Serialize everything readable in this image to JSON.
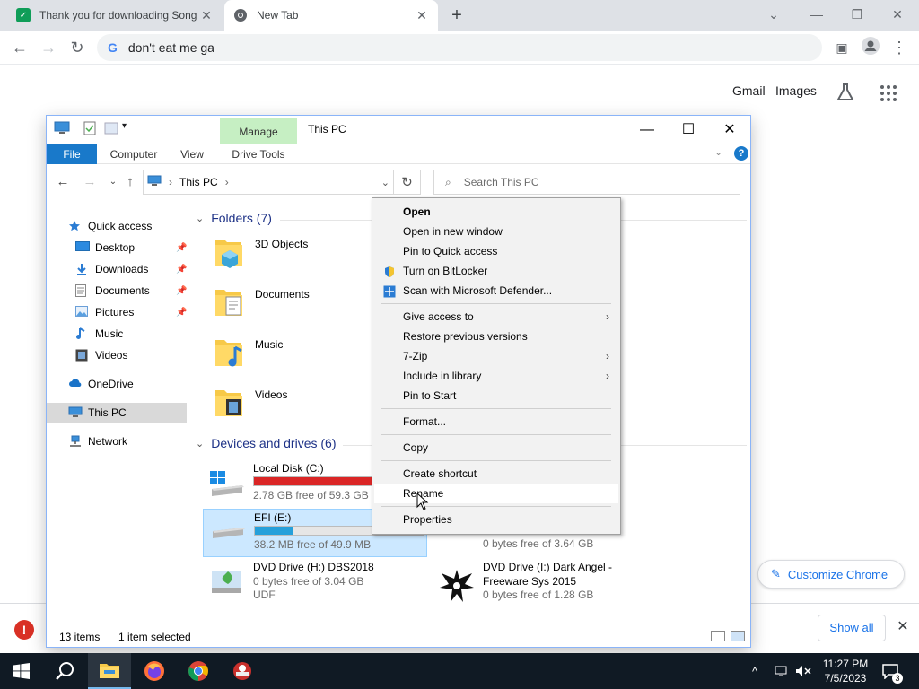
{
  "chrome": {
    "tabs": [
      {
        "title": "Thank you for downloading Song",
        "favicon": "sheet-icon",
        "color": "#0f9d58"
      },
      {
        "title": "New Tab",
        "favicon": "chrome-icon"
      }
    ],
    "omnibox": "don't eat me ga",
    "ntp_links": {
      "gmail": "Gmail",
      "images": "Images"
    },
    "customize_label": "Customize Chrome",
    "download_bar": {
      "show_all": "Show all"
    }
  },
  "explorer": {
    "title": "This PC",
    "manage_tab": "Manage",
    "ribbon_tabs": [
      "File",
      "Computer",
      "View",
      "Drive Tools"
    ],
    "address": "This PC",
    "search_placeholder": "Search This PC",
    "nav_items": [
      {
        "label": "Quick access",
        "icon": "star-icon"
      },
      {
        "label": "Desktop",
        "icon": "desktop-icon",
        "pinned": true
      },
      {
        "label": "Downloads",
        "icon": "download-icon",
        "pinned": true
      },
      {
        "label": "Documents",
        "icon": "document-icon",
        "pinned": true
      },
      {
        "label": "Pictures",
        "icon": "picture-icon",
        "pinned": true
      },
      {
        "label": "Music",
        "icon": "music-icon"
      },
      {
        "label": "Videos",
        "icon": "video-icon"
      },
      {
        "label": "OneDrive",
        "icon": "cloud-icon"
      },
      {
        "label": "This PC",
        "icon": "computer-icon",
        "selected": true
      },
      {
        "label": "Network",
        "icon": "network-icon"
      }
    ],
    "folders_header": "Folders (7)",
    "folders": [
      "3D Objects",
      "Documents",
      "Music",
      "Videos"
    ],
    "devices_header": "Devices and drives (6)",
    "drives": [
      {
        "name": "Local Disk (C:)",
        "free": "2.78 GB free of 59.3 GB",
        "used_fraction": 0.95,
        "bar_color": "#da2626"
      },
      {
        "name": "EFI (E:)",
        "free": "38.2 MB free of 49.9 MB",
        "used_fraction": 0.23,
        "bar_color": "#26a0da",
        "selected": true
      },
      {
        "partial": "(...)",
        "free": "0 bytes free of 3.64 GB"
      },
      {
        "name": "DVD Drive (H:) DBS2018",
        "line2": "0 bytes free of 3.04 GB",
        "line3": "UDF"
      },
      {
        "name": "DVD Drive (I:) Dark Angel -",
        "line2": "Freeware Sys 2015",
        "line3": "0 bytes free of 1.28 GB"
      }
    ],
    "status": {
      "items": "13 items",
      "selected": "1 item selected"
    }
  },
  "context_menu": {
    "items": [
      {
        "label": "Open",
        "bold": true
      },
      {
        "label": "Open in new window"
      },
      {
        "label": "Pin to Quick access"
      },
      {
        "label": "Turn on BitLocker",
        "icon": "shield-icon"
      },
      {
        "label": "Scan with Microsoft Defender...",
        "icon": "defender-icon"
      },
      {
        "label": "Give access to",
        "submenu": true
      },
      {
        "label": "Restore previous versions"
      },
      {
        "label": "7-Zip",
        "submenu": true
      },
      {
        "label": "Include in library",
        "submenu": true
      },
      {
        "label": "Pin to Start"
      },
      {
        "label": "Format..."
      },
      {
        "label": "Copy"
      },
      {
        "label": "Create shortcut"
      },
      {
        "label": "Rename",
        "hover": true
      },
      {
        "label": "Properties"
      }
    ]
  },
  "taskbar": {
    "time": "11:27 PM",
    "date": "7/5/2023",
    "notifications": "3"
  }
}
